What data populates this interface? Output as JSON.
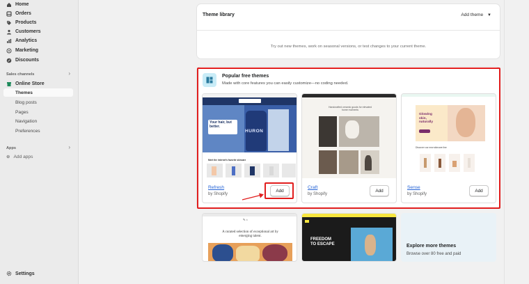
{
  "sidebar": {
    "items": [
      {
        "label": "Home",
        "icon": "home-icon"
      },
      {
        "label": "Orders",
        "icon": "orders-icon"
      },
      {
        "label": "Products",
        "icon": "tag-icon"
      },
      {
        "label": "Customers",
        "icon": "person-icon"
      },
      {
        "label": "Analytics",
        "icon": "chart-icon"
      },
      {
        "label": "Marketing",
        "icon": "target-icon"
      },
      {
        "label": "Discounts",
        "icon": "discount-icon"
      }
    ],
    "sales_channels_label": "Sales channels",
    "online_store": "Online Store",
    "sub_items": [
      "Themes",
      "Blog posts",
      "Pages",
      "Navigation",
      "Preferences"
    ],
    "apps_label": "Apps",
    "add_apps": "Add apps",
    "settings": "Settings"
  },
  "theme_library": {
    "title": "Theme library",
    "add_theme": "Add theme",
    "empty_text": "Try out new themes, work on seasonal versions, or test changes to your current theme."
  },
  "popular": {
    "title": "Popular free themes",
    "subtitle": "Made with core features you can easily customize—no coding needed.",
    "themes": [
      {
        "name": "Refresh",
        "by": "by Shopify",
        "add": "Add",
        "hero": "Your hair, but better.",
        "brand": "HURON",
        "section": "Meet the internet's favorite skincare"
      },
      {
        "name": "Craft",
        "by": "by Shopify",
        "add": "Add",
        "hero": "Handcrafted ceramic goods for elevated home moments"
      },
      {
        "name": "Sense",
        "by": "by Shopify",
        "add": "Add",
        "hero": "Glowing skin, naturally",
        "section": "Discover our new skincare line"
      }
    ]
  },
  "more": {
    "publisher_tagline": "A curated selection of exceptional art by emerging talent.",
    "banner": "FREEDOM TO ESCAPE",
    "explore_title": "Explore more themes",
    "explore_sub": "Browse over 80 free and paid"
  },
  "colors": {
    "accent_red": "#e11d1d",
    "link_blue": "#2463d6",
    "icon_bg": "#c9ecf7"
  }
}
